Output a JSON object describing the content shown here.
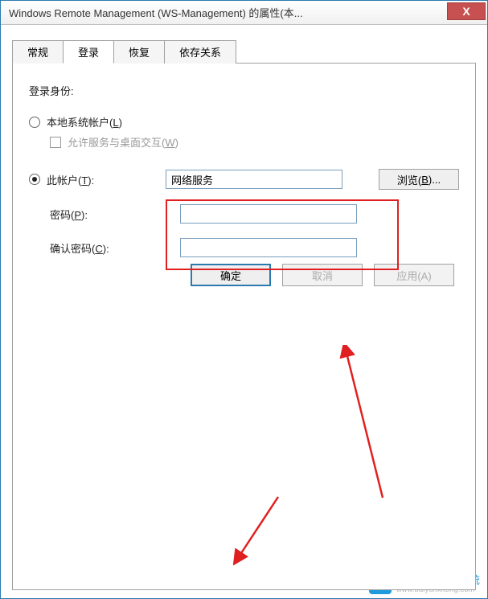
{
  "titlebar": {
    "title": "Windows Remote Management (WS-Management) 的属性(本...",
    "close": "X"
  },
  "tabs": {
    "general": "常规",
    "logon": "登录",
    "recovery": "恢复",
    "dependencies": "依存关系"
  },
  "logon": {
    "identity_label": "登录身份:",
    "local_system_label": "本地系统帐户(L)",
    "local_system_hotkey": "L",
    "interact_label": "允许服务与桌面交互(W)",
    "interact_hotkey": "W",
    "this_account_label": "此帐户(T):",
    "this_account_hotkey": "T",
    "account_value": "网络服务",
    "browse_label": "浏览(B)...",
    "browse_hotkey": "B",
    "password_label": "密码(P):",
    "password_hotkey": "P",
    "confirm_label": "确认密码(C):",
    "confirm_hotkey": "C"
  },
  "footer": {
    "ok": "确定",
    "cancel": "取消",
    "apply": "应用(A)"
  },
  "watermark": {
    "text1": "白云一键重装系统",
    "text2": "www.baiyunxitong.com"
  }
}
